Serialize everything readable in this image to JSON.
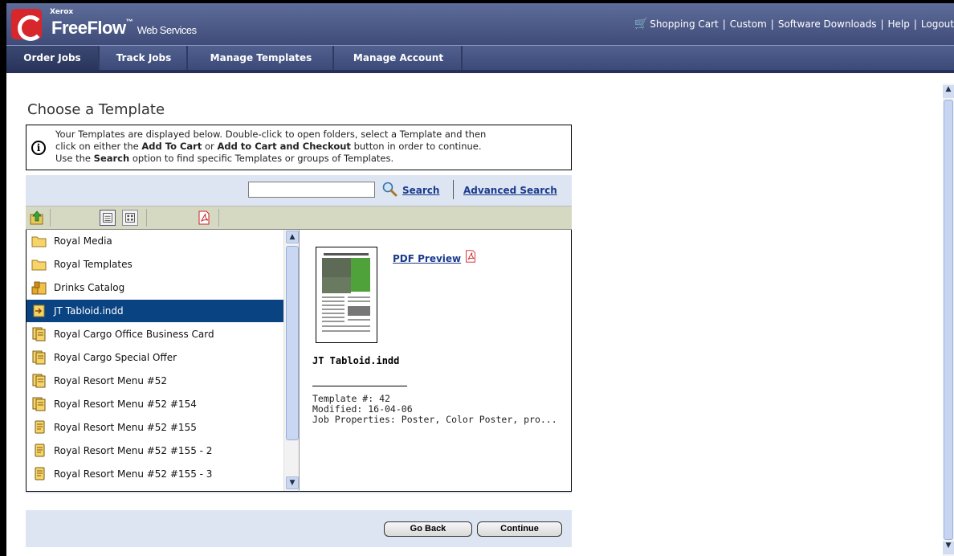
{
  "header": {
    "brand_small": "Xerox",
    "brand_name": "FreeFlow",
    "brand_sub": "Web Services",
    "links": [
      "Shopping Cart",
      "Custom",
      "Software Downloads",
      "Help",
      "Logout"
    ]
  },
  "nav": {
    "tabs": [
      {
        "label": "Order Jobs",
        "active": true
      },
      {
        "label": "Track Jobs",
        "active": false
      },
      {
        "label": "Manage Templates",
        "active": false
      },
      {
        "label": "Manage Account",
        "active": false
      }
    ]
  },
  "page": {
    "title": "Choose a Template",
    "info": {
      "line1": "Your Templates are displayed below. Double-click to open folders, select a Template and then",
      "line2_a": "click on either the ",
      "line2_b": "Add To Cart",
      "line2_c": " or ",
      "line2_d": "Add to Cart and Checkout",
      "line2_e": " button in order to continue.",
      "line3_a": "Use the ",
      "line3_b": "Search",
      "line3_c": " option to find specific Templates or groups of Templates."
    }
  },
  "search": {
    "placeholder": "",
    "value": "",
    "search_label": "Search",
    "advanced_label": "Advanced Search"
  },
  "templates": {
    "items": [
      {
        "label": "Royal Media",
        "icon": "folder-icon"
      },
      {
        "label": "Royal Templates",
        "icon": "folder-icon"
      },
      {
        "label": "Drinks Catalog",
        "icon": "catalog-icon"
      },
      {
        "label": "JT Tabloid.indd",
        "icon": "indesign-template-icon",
        "selected": true
      },
      {
        "label": "Royal Cargo Office Business Card",
        "icon": "template-stack-icon"
      },
      {
        "label": "Royal Cargo Special Offer",
        "icon": "template-stack-icon"
      },
      {
        "label": "Royal Resort Menu #52",
        "icon": "template-stack-icon"
      },
      {
        "label": "Royal Resort Menu #52 #154",
        "icon": "template-stack-icon"
      },
      {
        "label": "Royal Resort Menu #52 #155",
        "icon": "template-doc-icon"
      },
      {
        "label": "Royal Resort Menu #52 #155 - 2",
        "icon": "template-doc-icon"
      },
      {
        "label": "Royal Resort Menu #52 #155 - 3",
        "icon": "template-doc-icon"
      }
    ]
  },
  "preview": {
    "pdf_preview_label": "PDF Preview",
    "name": "JT Tabloid.indd",
    "template_number": "Template #: 42",
    "modified": "Modified: 16-04-06",
    "job_properties": "Job Properties: Poster, Color Poster, pro..."
  },
  "footer": {
    "back_label": "Go Back",
    "continue_label": "Continue"
  },
  "colors": {
    "header_bg": "#4a5785",
    "selected_row": "#0a4382",
    "link": "#1a3a8c",
    "panel_bg": "#dde5f3",
    "toolbar_bg": "#d6d9c2"
  }
}
